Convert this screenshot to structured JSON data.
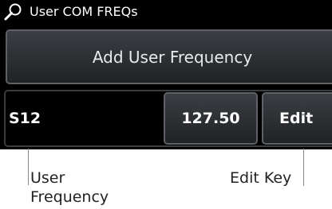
{
  "title_bar": {
    "title": "User COM FREQs",
    "icon": "magnifier-icon"
  },
  "actions": {
    "add_label": "Add User Frequency"
  },
  "frequency_row": {
    "name": "S12",
    "frequency": "127.50",
    "edit_label": "Edit"
  },
  "callouts": {
    "user_frequency": [
      "User",
      "Frequency"
    ],
    "edit_key": "Edit Key"
  },
  "colors": {
    "screen_background": "#000000",
    "button_face": "#2c2e32",
    "button_border": "#5e6166",
    "text": "#ffffff",
    "callout_text": "#222222"
  }
}
